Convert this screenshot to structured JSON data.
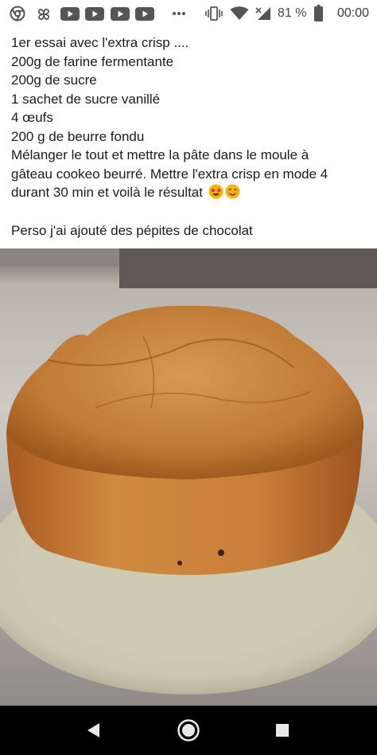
{
  "status_bar": {
    "icons": [
      "chrome-icon",
      "pinwheel-icon",
      "youtube-icon",
      "youtube-icon",
      "youtube-icon",
      "youtube-icon",
      "more-dots-icon",
      "vibrate-icon",
      "wifi-icon",
      "signal-icon",
      "battery-icon"
    ],
    "battery": "81 %",
    "time": "00:00"
  },
  "post": {
    "lines": [
      "1er essai avec l'extra crisp ....",
      "200g de farine fermentante",
      "200g de sucre",
      "1 sachet de sucre vanillé",
      "4 œufs",
      "200 g de beurre fondu",
      "Mélanger le tout et mettre la pâte dans le moule à",
      "gâteau cookeo  beurré. Mettre l'extra crisp en mode 4",
      "durant 30 min et voilà le résultat"
    ],
    "emojis": [
      "star-struck-emoji",
      "smiling-face-emoji"
    ],
    "note": "Perso j'ai ajouté des pépites de chocolat"
  },
  "nav_bar": {
    "buttons": [
      "back-button",
      "home-button",
      "recents-button"
    ]
  }
}
